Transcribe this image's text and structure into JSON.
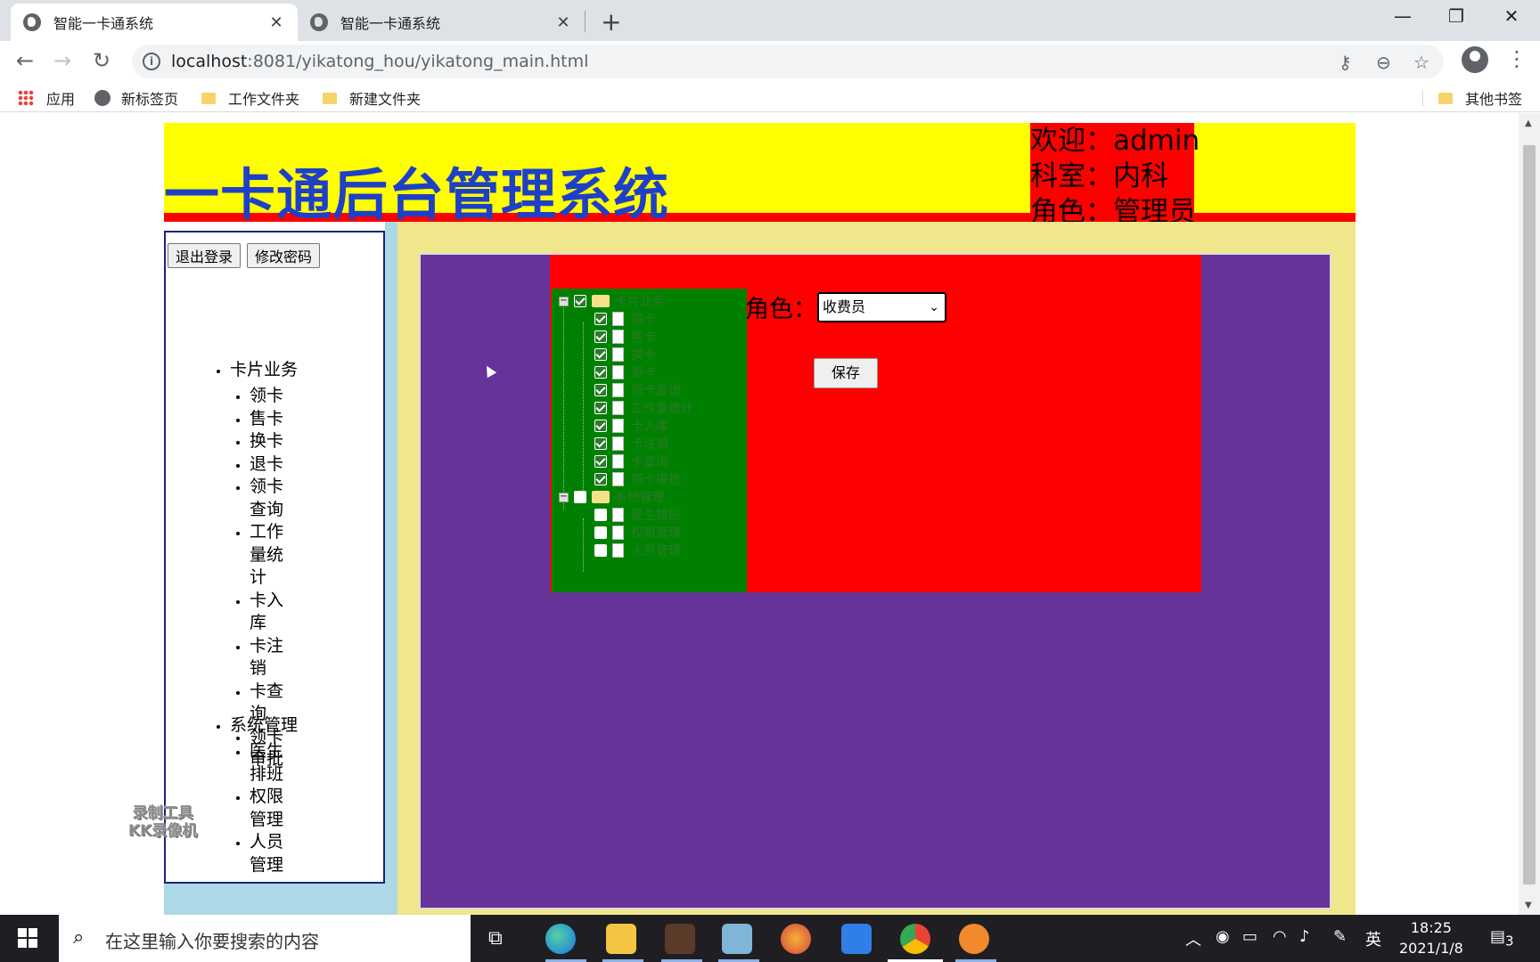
{
  "browser": {
    "tabs": [
      {
        "title": "智能一卡通系统",
        "close": "✕"
      },
      {
        "title": "智能一卡通系统",
        "close": "✕"
      }
    ],
    "new_tab": "+",
    "window": {
      "minimize": "—",
      "restore": "❐",
      "close": "✕"
    },
    "nav": {
      "back": "←",
      "forward": "→",
      "reload": "↻"
    },
    "url": {
      "host": "localhost",
      "rest": ":8081/yikatong_hou/yikatong_main.html"
    },
    "omnibox_icons": {
      "key": "⚷",
      "zoom": "⊖",
      "star": "☆"
    },
    "menu": "⋮",
    "bookmarks": [
      "应用",
      "新标签页",
      "工作文件夹",
      "新建文件夹"
    ],
    "other_bookmarks": "其他书签"
  },
  "page": {
    "title": "一卡通后台管理系统",
    "user": {
      "welcome": "欢迎：admin",
      "department": "科室：内科",
      "role": "角色：管理员"
    },
    "buttons": {
      "logout": "退出登录",
      "change_password": "修改密码"
    },
    "menu": [
      {
        "label": "卡片业务",
        "items": [
          "领卡",
          "售卡",
          "换卡",
          "退卡",
          "领卡查询",
          "工作量统计",
          "卡入库",
          "卡注销",
          "卡查询",
          "领卡审批"
        ]
      },
      {
        "label": "系统管理",
        "items": [
          "医生排班",
          "权限管理",
          "人员管理"
        ]
      }
    ],
    "tree": {
      "groups": [
        {
          "label": "卡片业务",
          "checked": true,
          "children": [
            "领卡",
            "售卡",
            "换卡",
            "退卡",
            "领卡查询",
            "工作量统计",
            "卡入库",
            "卡注销",
            "卡查询",
            "领卡审批"
          ]
        },
        {
          "label": "系统管理",
          "checked": false,
          "children": [
            "医生排班",
            "权限管理",
            "人员管理"
          ]
        }
      ]
    },
    "role_label": "角色：",
    "role_selected": "收费员",
    "save": "保存",
    "watermark": [
      "录制工具",
      "KK录像机"
    ],
    "colors": {
      "header_bg": "#ffff00",
      "title": "#1e40c8",
      "user_box": "#ff0000",
      "main_bg": "#663399",
      "tree_bg": "#008000",
      "frame": "#f0e68c",
      "sidebar_strip": "#add8e6"
    }
  },
  "taskbar": {
    "search_placeholder": "在这里输入你要搜索的内容",
    "ime": "英",
    "time": "18:25",
    "date": "2021/1/8",
    "notifications": "3"
  }
}
